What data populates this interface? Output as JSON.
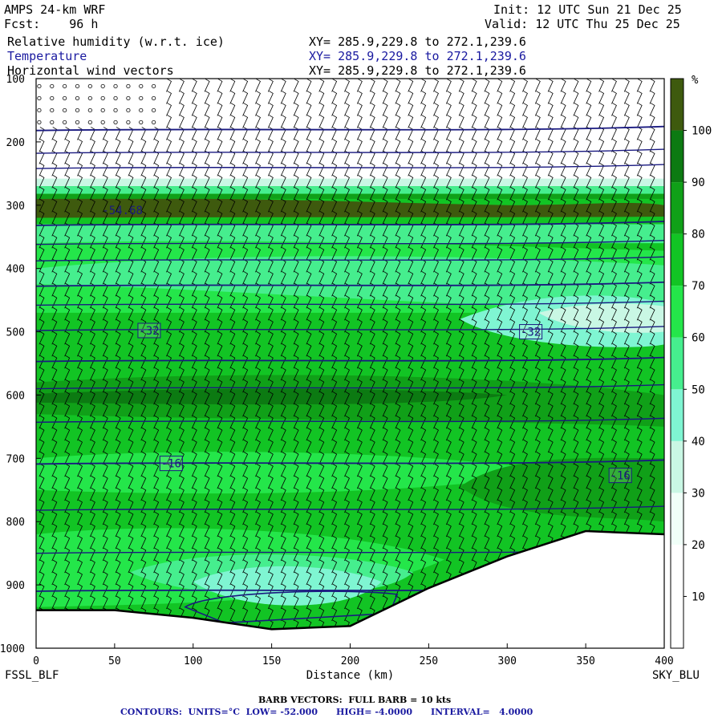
{
  "header": {
    "model": "AMPS 24-km WRF",
    "init": "Init: 12 UTC Sun 21 Dec 25",
    "fcst": "Fcst:    96 h",
    "valid": "Valid: 12 UTC Thu 25 Dec 25",
    "fields": [
      {
        "name": "Relative humidity (w.r.t. ice)",
        "xy": "XY= 285.9,229.8 to 272.1,239.6",
        "color": "#000000"
      },
      {
        "name": "Temperature",
        "xy": "XY= 285.9,229.8 to 272.1,239.6",
        "color": "#1a1aa0"
      },
      {
        "name": "Horizontal wind vectors",
        "xy": "XY= 285.9,229.8 to 272.1,239.6",
        "color": "#000000"
      }
    ]
  },
  "chart_data": {
    "type": "heatmap",
    "title": "",
    "xlabel": "Distance (km)",
    "ylabel": "",
    "x_ticks": [
      0,
      50,
      100,
      150,
      200,
      250,
      300,
      350,
      400
    ],
    "y_ticks": [
      100,
      200,
      300,
      400,
      500,
      600,
      700,
      800,
      900,
      1000
    ],
    "xlim": [
      0,
      400
    ],
    "ylim": [
      1000,
      100
    ],
    "left_endpoint": "FSSL_BLF",
    "right_endpoint": "SKY_BLU",
    "colorbar": {
      "unit": "%",
      "levels": [
        10,
        20,
        30,
        40,
        50,
        60,
        70,
        80,
        90,
        100
      ],
      "colors": [
        "#ffffff",
        "#ffffff",
        "#f0fff8",
        "#c9f7e4",
        "#7ff5d2",
        "#46ee8e",
        "#24e64a",
        "#12c424",
        "#10a018",
        "#0c7a12",
        "#3e5a0e"
      ]
    },
    "temperature_contour_labels": [
      {
        "label": "-54.68",
        "x_km": 55,
        "p_hpa": 308
      },
      {
        "label": "-32",
        "x_km": 72,
        "p_hpa": 498
      },
      {
        "label": "-32",
        "x_km": 315,
        "p_hpa": 500
      },
      {
        "label": "-16",
        "x_km": 86,
        "p_hpa": 708
      },
      {
        "label": "-16",
        "x_km": 372,
        "p_hpa": 727
      }
    ],
    "temperature_isotherms_hpa": [
      182,
      218,
      242,
      332,
      362,
      388,
      428,
      458,
      498,
      547,
      590,
      643,
      709,
      782,
      850,
      910
    ],
    "terrain_surface": [
      {
        "x_km": 0,
        "p_hpa": 940
      },
      {
        "x_km": 50,
        "p_hpa": 940
      },
      {
        "x_km": 100,
        "p_hpa": 952
      },
      {
        "x_km": 150,
        "p_hpa": 970
      },
      {
        "x_km": 200,
        "p_hpa": 965
      },
      {
        "x_km": 250,
        "p_hpa": 905
      },
      {
        "x_km": 300,
        "p_hpa": 855
      },
      {
        "x_km": 350,
        "p_hpa": 815
      },
      {
        "x_km": 400,
        "p_hpa": 820
      }
    ]
  },
  "footer": {
    "barb": "BARB VECTORS:  FULL BARB = 10 kts",
    "contours": "CONTOURS:  UNITS=°C  LOW= -52.000      HIGH= -4.0000      INTERVAL=   4.0000"
  }
}
